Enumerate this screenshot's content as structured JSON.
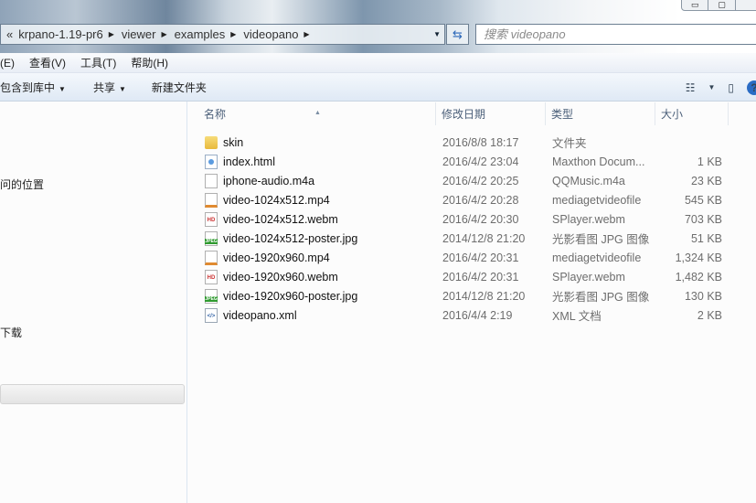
{
  "window": {
    "buttons": [
      "minimize",
      "maximize",
      "close"
    ]
  },
  "address": {
    "overflow": "«",
    "crumbs": [
      "krpano-1.19-pr6",
      "viewer",
      "examples",
      "videopano"
    ]
  },
  "search": {
    "placeholder": "搜索 videopano"
  },
  "menu": [
    "(E)",
    "查看(V)",
    "工具(T)",
    "帮助(H)"
  ],
  "toolbar": {
    "include_library": "包含到库中",
    "share": "共享",
    "new_folder": "新建文件夹"
  },
  "nav": {
    "item1": "问的位置",
    "item2": "下载"
  },
  "columns": {
    "name": "名称",
    "date": "修改日期",
    "type": "类型",
    "size": "大小"
  },
  "files": [
    {
      "icon": "folder",
      "name": "skin",
      "date": "2016/8/8 18:17",
      "type": "文件夹",
      "size": ""
    },
    {
      "icon": "html",
      "name": "index.html",
      "date": "2016/4/2 23:04",
      "type": "Maxthon Docum...",
      "size": "1 KB"
    },
    {
      "icon": "blank",
      "name": "iphone-audio.m4a",
      "date": "2016/4/2 20:25",
      "type": "QQMusic.m4a",
      "size": "23 KB"
    },
    {
      "icon": "mp4",
      "name": "video-1024x512.mp4",
      "date": "2016/4/2 20:28",
      "type": "mediagetvideofile",
      "size": "545 KB"
    },
    {
      "icon": "webm",
      "name": "video-1024x512.webm",
      "date": "2016/4/2 20:30",
      "type": "SPlayer.webm",
      "size": "703 KB"
    },
    {
      "icon": "jpg",
      "name": "video-1024x512-poster.jpg",
      "date": "2014/12/8 21:20",
      "type": "光影看图 JPG 图像",
      "size": "51 KB"
    },
    {
      "icon": "mp4",
      "name": "video-1920x960.mp4",
      "date": "2016/4/2 20:31",
      "type": "mediagetvideofile",
      "size": "1,324 KB"
    },
    {
      "icon": "webm",
      "name": "video-1920x960.webm",
      "date": "2016/4/2 20:31",
      "type": "SPlayer.webm",
      "size": "1,482 KB"
    },
    {
      "icon": "jpg",
      "name": "video-1920x960-poster.jpg",
      "date": "2014/12/8 21:20",
      "type": "光影看图 JPG 图像",
      "size": "130 KB"
    },
    {
      "icon": "xml",
      "name": "videopano.xml",
      "date": "2016/4/4 2:19",
      "type": "XML 文档",
      "size": "2 KB"
    }
  ]
}
